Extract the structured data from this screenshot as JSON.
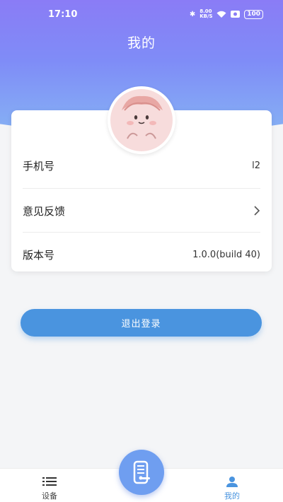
{
  "status_bar": {
    "time": "17:10",
    "net_speed": "8.00 KB/S",
    "battery": "100"
  },
  "header": {
    "title": "我的"
  },
  "profile": {
    "avatar_icon": "cartoon-avatar-icon",
    "rows": [
      {
        "label": "手机号",
        "value": "l2"
      },
      {
        "label": "意见反馈",
        "value": ""
      },
      {
        "label": "版本号",
        "value": "1.0.0(build 40)"
      }
    ]
  },
  "actions": {
    "logout_label": "退出登录"
  },
  "tabbar": {
    "tabs": [
      {
        "label": "设备",
        "icon": "list-icon"
      },
      {
        "label": "我的",
        "icon": "person-icon"
      }
    ],
    "center_icon": "door-lock-icon"
  },
  "colors": {
    "header_gradient_top": "#8a7cf6",
    "header_gradient_bottom": "#86b2f4",
    "accent": "#4a94df"
  }
}
